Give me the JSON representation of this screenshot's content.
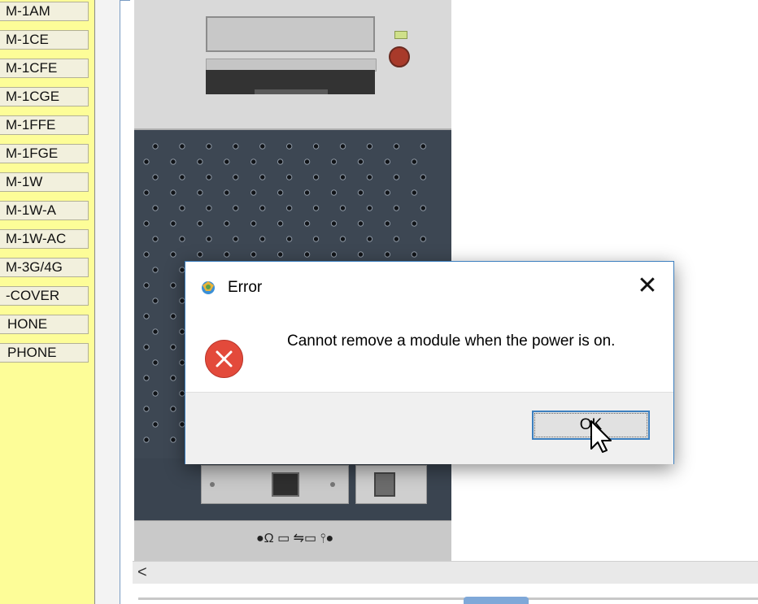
{
  "module_list": [
    "M-1AM",
    "M-1CE",
    "M-1CFE",
    "M-1CGE",
    "M-1FFE",
    "M-1FGE",
    "M-1W",
    "M-1W-A",
    "M-1W-AC",
    "M-3G/4G",
    "-COVER",
    "HONE",
    "PHONE"
  ],
  "dialog": {
    "title": "Error",
    "message": "Cannot remove a module when the power is on.",
    "ok_label": "OK",
    "close_glyph": "✕"
  },
  "scrollbar": {
    "left_arrow": "<"
  },
  "io_panel": {
    "glyphs": "●Ω ▭ ⇋▭ ⫯●"
  },
  "colors": {
    "module_panel_bg": "#fdfd98",
    "dialog_accent": "#3c7fbf",
    "error_red": "#e34a3b",
    "grille": "#3d4753"
  },
  "icons": [
    "error-icon",
    "app-icon",
    "close-icon",
    "scroll-left-icon",
    "cursor-icon",
    "power-button-icon"
  ]
}
